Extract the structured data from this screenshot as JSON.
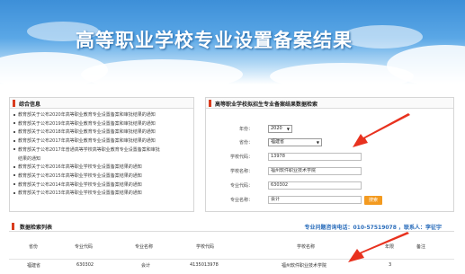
{
  "banner": {
    "title": "高等职业学校专业设置备案结果"
  },
  "news": {
    "title": "综合信息",
    "items": [
      "教育部关于公布2020年高等职业教育专业设置备案和审批结果的通知",
      "教育部关于公布2019年高等职业教育专业设置备案和审批结果的通知",
      "教育部关于公布2018年高等职业教育专业设置备案和审批结果的通知",
      "教育部关于公布2017年高等职业教育专业设置备案和审批结果的通知",
      "教育部关于公布2017年普通高等学校高等职业教育专业设置备案和审批",
      "结果的通知",
      "教育部关于公布2016年高等职业学校专业设置备案结果的通知",
      "教育部关于公布2015年高等职业学校专业设置备案结果的通知",
      "教育部关于公布2014年高等职业学校专业设置备案结果的通知",
      "教育部关于公布2013年高等职业学校专业设置备案结果的通知"
    ]
  },
  "search": {
    "title": "高等职业学校拟招生专业备案结果数据检索",
    "year_label": "年份：",
    "year_value": "2020",
    "province_label": "省份：",
    "province_value": "福建省",
    "school_code_label": "学校代码：",
    "school_code_value": "13978",
    "school_name_label": "学校名称：",
    "school_name_value": "福州软件职业技术学院",
    "major_code_label": "专业代码：",
    "major_code_value": "630302",
    "major_name_label": "专业名称：",
    "major_name_value": "会计",
    "button_label": "搜索"
  },
  "results": {
    "title": "数据检索列表",
    "contact": "专业问题咨询电话：010-57519078 ，联系人：李征宇",
    "columns": [
      "省份",
      "专业代码",
      "专业名称",
      "学校代码",
      "学校名称",
      "年限",
      "备注"
    ],
    "rows": [
      [
        "福建省",
        "630302",
        "会计",
        "4135013978",
        "福州软件职业技术学院",
        "3",
        ""
      ]
    ]
  },
  "colors": {
    "accent": "#d93c1e",
    "arrow": "#e8321f",
    "button": "#f39a1f",
    "contact": "#2a6dbb"
  }
}
